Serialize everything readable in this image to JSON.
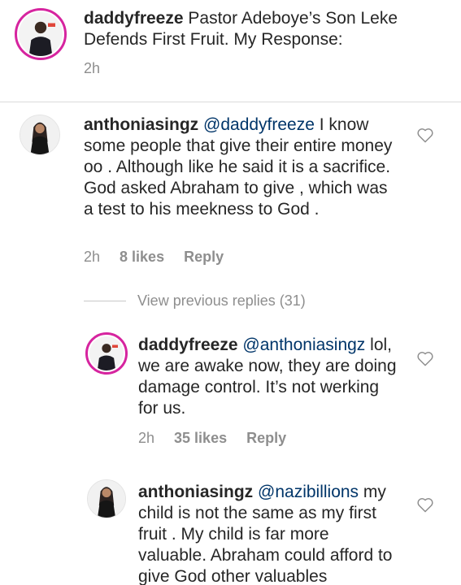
{
  "caption": {
    "username": "daddyfreeze",
    "text": " Pastor Adeboye’s Son Leke Defends First Fruit. My Response:",
    "time": "2h"
  },
  "comments": [
    {
      "username": "anthoniasingz",
      "mention": "@daddyfreeze",
      "text": " I know some people that give their entire money oo . Although like he said it is a sacrifice. God asked Abraham to give , which was a test to his meekness to God .",
      "time": "2h",
      "likes": "8 likes",
      "reply": "Reply"
    }
  ],
  "view_previous": "View previous replies (31)",
  "replies": [
    {
      "username": "daddyfreeze",
      "mention": "@anthoniasingz",
      "text": " lol, we are awake now, they are doing damage control. It’s not werking for us.",
      "time": "2h",
      "likes": "35 likes",
      "reply": "Reply"
    },
    {
      "username": "anthoniasingz",
      "mention": "@nazibillions",
      "text": " my child is not the same as my first fruit . My child is far more valuable. Abraham could afford to give God other valuables"
    }
  ],
  "colors": {
    "username": "#262626",
    "mention": "#003569",
    "meta": "#8e8e8e",
    "story_ring": "#d6249f"
  },
  "icons": {
    "like": "heart-outline-icon",
    "avatar": "profile-photo"
  }
}
